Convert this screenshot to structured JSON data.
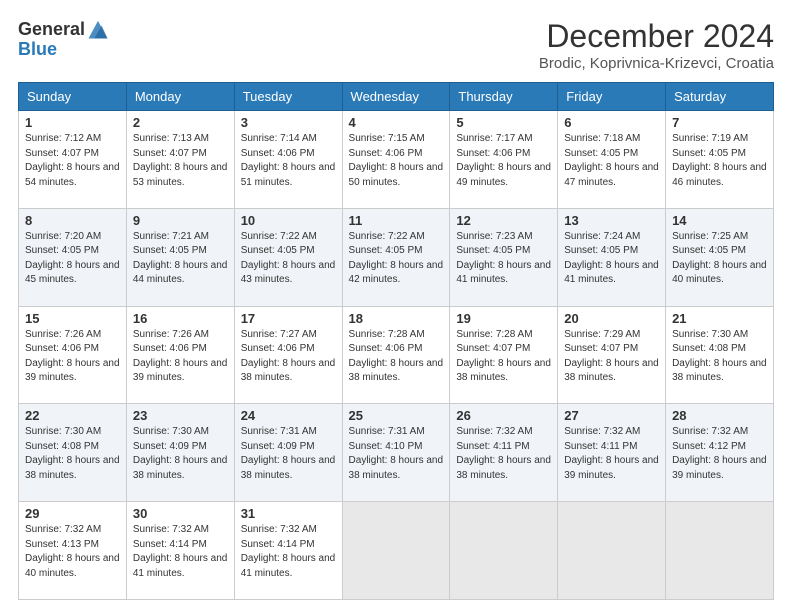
{
  "header": {
    "logo_general": "General",
    "logo_blue": "Blue",
    "month_title": "December 2024",
    "location": "Brodic, Koprivnica-Krizevci, Croatia"
  },
  "days_of_week": [
    "Sunday",
    "Monday",
    "Tuesday",
    "Wednesday",
    "Thursday",
    "Friday",
    "Saturday"
  ],
  "weeks": [
    [
      {
        "day": "1",
        "sunrise": "7:12 AM",
        "sunset": "4:07 PM",
        "daylight": "8 hours and 54 minutes."
      },
      {
        "day": "2",
        "sunrise": "7:13 AM",
        "sunset": "4:07 PM",
        "daylight": "8 hours and 53 minutes."
      },
      {
        "day": "3",
        "sunrise": "7:14 AM",
        "sunset": "4:06 PM",
        "daylight": "8 hours and 51 minutes."
      },
      {
        "day": "4",
        "sunrise": "7:15 AM",
        "sunset": "4:06 PM",
        "daylight": "8 hours and 50 minutes."
      },
      {
        "day": "5",
        "sunrise": "7:17 AM",
        "sunset": "4:06 PM",
        "daylight": "8 hours and 49 minutes."
      },
      {
        "day": "6",
        "sunrise": "7:18 AM",
        "sunset": "4:05 PM",
        "daylight": "8 hours and 47 minutes."
      },
      {
        "day": "7",
        "sunrise": "7:19 AM",
        "sunset": "4:05 PM",
        "daylight": "8 hours and 46 minutes."
      }
    ],
    [
      {
        "day": "8",
        "sunrise": "7:20 AM",
        "sunset": "4:05 PM",
        "daylight": "8 hours and 45 minutes."
      },
      {
        "day": "9",
        "sunrise": "7:21 AM",
        "sunset": "4:05 PM",
        "daylight": "8 hours and 44 minutes."
      },
      {
        "day": "10",
        "sunrise": "7:22 AM",
        "sunset": "4:05 PM",
        "daylight": "8 hours and 43 minutes."
      },
      {
        "day": "11",
        "sunrise": "7:22 AM",
        "sunset": "4:05 PM",
        "daylight": "8 hours and 42 minutes."
      },
      {
        "day": "12",
        "sunrise": "7:23 AM",
        "sunset": "4:05 PM",
        "daylight": "8 hours and 41 minutes."
      },
      {
        "day": "13",
        "sunrise": "7:24 AM",
        "sunset": "4:05 PM",
        "daylight": "8 hours and 41 minutes."
      },
      {
        "day": "14",
        "sunrise": "7:25 AM",
        "sunset": "4:05 PM",
        "daylight": "8 hours and 40 minutes."
      }
    ],
    [
      {
        "day": "15",
        "sunrise": "7:26 AM",
        "sunset": "4:06 PM",
        "daylight": "8 hours and 39 minutes."
      },
      {
        "day": "16",
        "sunrise": "7:26 AM",
        "sunset": "4:06 PM",
        "daylight": "8 hours and 39 minutes."
      },
      {
        "day": "17",
        "sunrise": "7:27 AM",
        "sunset": "4:06 PM",
        "daylight": "8 hours and 38 minutes."
      },
      {
        "day": "18",
        "sunrise": "7:28 AM",
        "sunset": "4:06 PM",
        "daylight": "8 hours and 38 minutes."
      },
      {
        "day": "19",
        "sunrise": "7:28 AM",
        "sunset": "4:07 PM",
        "daylight": "8 hours and 38 minutes."
      },
      {
        "day": "20",
        "sunrise": "7:29 AM",
        "sunset": "4:07 PM",
        "daylight": "8 hours and 38 minutes."
      },
      {
        "day": "21",
        "sunrise": "7:30 AM",
        "sunset": "4:08 PM",
        "daylight": "8 hours and 38 minutes."
      }
    ],
    [
      {
        "day": "22",
        "sunrise": "7:30 AM",
        "sunset": "4:08 PM",
        "daylight": "8 hours and 38 minutes."
      },
      {
        "day": "23",
        "sunrise": "7:30 AM",
        "sunset": "4:09 PM",
        "daylight": "8 hours and 38 minutes."
      },
      {
        "day": "24",
        "sunrise": "7:31 AM",
        "sunset": "4:09 PM",
        "daylight": "8 hours and 38 minutes."
      },
      {
        "day": "25",
        "sunrise": "7:31 AM",
        "sunset": "4:10 PM",
        "daylight": "8 hours and 38 minutes."
      },
      {
        "day": "26",
        "sunrise": "7:32 AM",
        "sunset": "4:11 PM",
        "daylight": "8 hours and 38 minutes."
      },
      {
        "day": "27",
        "sunrise": "7:32 AM",
        "sunset": "4:11 PM",
        "daylight": "8 hours and 39 minutes."
      },
      {
        "day": "28",
        "sunrise": "7:32 AM",
        "sunset": "4:12 PM",
        "daylight": "8 hours and 39 minutes."
      }
    ],
    [
      {
        "day": "29",
        "sunrise": "7:32 AM",
        "sunset": "4:13 PM",
        "daylight": "8 hours and 40 minutes."
      },
      {
        "day": "30",
        "sunrise": "7:32 AM",
        "sunset": "4:14 PM",
        "daylight": "8 hours and 41 minutes."
      },
      {
        "day": "31",
        "sunrise": "7:32 AM",
        "sunset": "4:14 PM",
        "daylight": "8 hours and 41 minutes."
      },
      null,
      null,
      null,
      null
    ]
  ],
  "labels": {
    "sunrise": "Sunrise:",
    "sunset": "Sunset:",
    "daylight": "Daylight:"
  }
}
